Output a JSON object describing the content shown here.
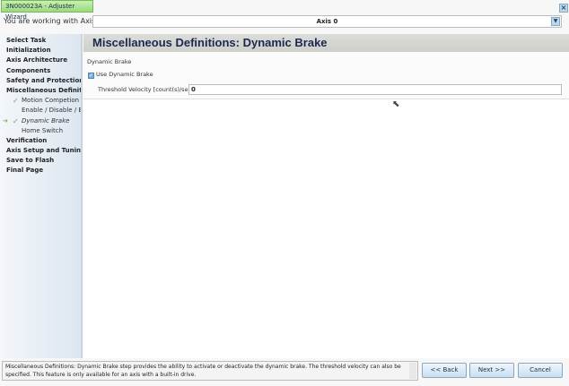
{
  "window": {
    "title": "3N000023A - Adjuster Wizard",
    "close_icon": "close-icon"
  },
  "axis": {
    "label": "You are working with Axis:",
    "value": "Axis 0"
  },
  "sidebar": {
    "items": [
      {
        "label": "Select Task",
        "level": 0
      },
      {
        "label": "Initialization",
        "level": 0
      },
      {
        "label": "Axis Architecture",
        "level": 0
      },
      {
        "label": "Components",
        "level": 0
      },
      {
        "label": "Safety and Protection",
        "level": 0
      },
      {
        "label": "Miscellaneous Definitions",
        "level": 0
      },
      {
        "label": "Motion Competion",
        "level": 1,
        "checked": true
      },
      {
        "label": "Enable / Disable / Brake",
        "level": 1
      },
      {
        "label": "Dynamic Brake",
        "level": 1,
        "checked": true,
        "current": true
      },
      {
        "label": "Home Switch",
        "level": 1
      },
      {
        "label": "Verification",
        "level": 0
      },
      {
        "label": "Axis Setup and Tuning",
        "level": 0
      },
      {
        "label": "Save to Flash",
        "level": 0
      },
      {
        "label": "Final Page",
        "level": 0
      }
    ]
  },
  "page": {
    "title": "Miscellaneous Definitions: Dynamic Brake",
    "group_title": "Dynamic Brake",
    "use_dynamic_brake": {
      "label": "Use Dynamic Brake",
      "checked": true
    },
    "threshold": {
      "label": "Threshold Velocity [count(s)/sec]",
      "value": "0"
    }
  },
  "status_text": "Miscellaneous Definitions: Dynamic Brake step provides the ability to activate or deactivate the dynamic brake.  The threshold velocity can also be specified.  This feature is only available for an axis with a built-in drive.",
  "buttons": {
    "back": "<< Back",
    "next": "Next >>",
    "cancel": "Cancel"
  }
}
